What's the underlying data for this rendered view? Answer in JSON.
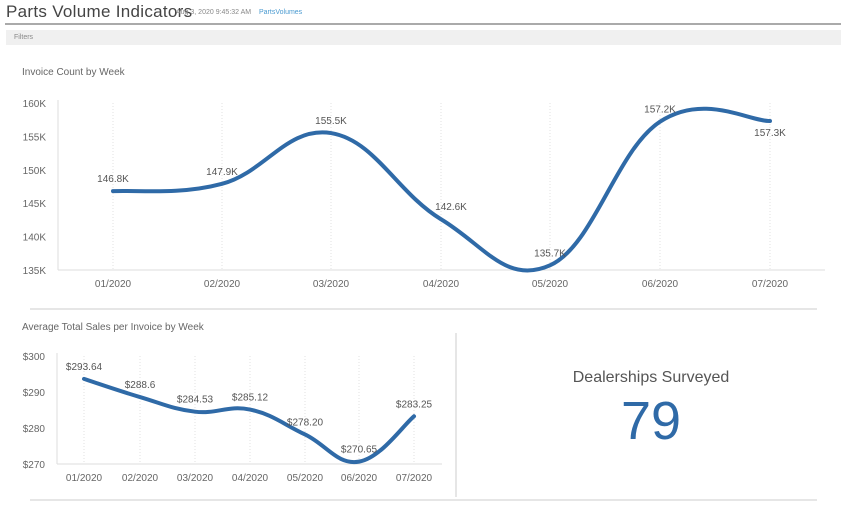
{
  "header": {
    "title": "Parts Volume Indicators",
    "timestamp": "Aug 3, 2020 9:45:32 AM",
    "link": "PartsVolumes"
  },
  "filters": {
    "label": "Filters"
  },
  "colors": {
    "line": "#2f6aa7",
    "accent": "#4a9ad0"
  },
  "kpi": {
    "label": "Dealerships Surveyed",
    "value": "79"
  },
  "chart_data": [
    {
      "type": "line",
      "title": "Invoice Count by Week",
      "categories": [
        "01/2020",
        "02/2020",
        "03/2020",
        "04/2020",
        "05/2020",
        "06/2020",
        "07/2020"
      ],
      "values": [
        146800,
        147900,
        155500,
        142600,
        135700,
        157200,
        157300
      ],
      "data_labels": [
        "146.8K",
        "147.9K",
        "155.5K",
        "142.6K",
        "135.7K",
        "157.2K",
        "157.3K"
      ],
      "yticks": [
        135000,
        140000,
        145000,
        150000,
        155000,
        160000
      ],
      "ytick_labels": [
        "135K",
        "140K",
        "145K",
        "150K",
        "155K",
        "160K"
      ],
      "ylim": [
        135000,
        160000
      ],
      "grid": "vertical-dotted"
    },
    {
      "type": "line",
      "title": "Average Total Sales per Invoice by Week",
      "categories": [
        "01/2020",
        "02/2020",
        "03/2020",
        "04/2020",
        "05/2020",
        "06/2020",
        "07/2020"
      ],
      "values": [
        293.64,
        288.6,
        284.53,
        285.12,
        278.2,
        270.65,
        283.25
      ],
      "data_labels": [
        "$293.64",
        "$288.6",
        "$284.53",
        "$285.12",
        "$278.20",
        "$270.65",
        "$283.25"
      ],
      "yticks": [
        270,
        280,
        290,
        300
      ],
      "ytick_labels": [
        "$270",
        "$280",
        "$290",
        "$300"
      ],
      "ylim": [
        270,
        300
      ],
      "grid": "vertical-dotted"
    }
  ]
}
